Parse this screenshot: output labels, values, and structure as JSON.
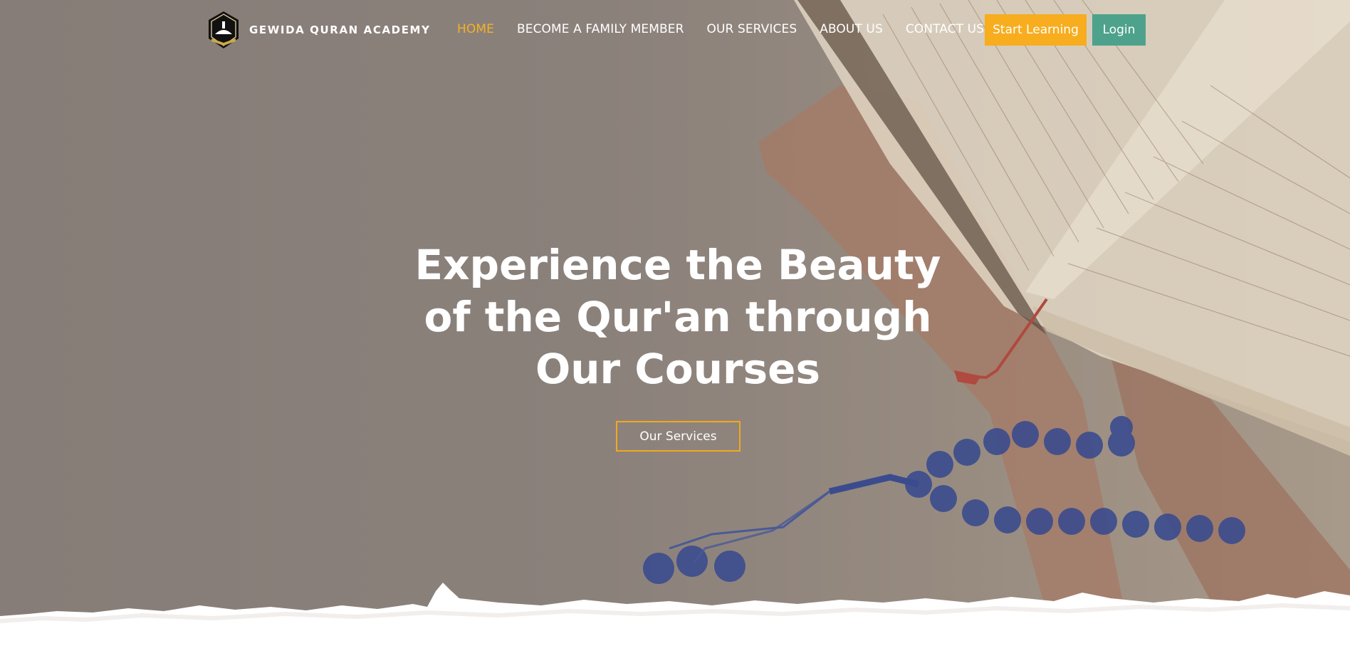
{
  "brand": {
    "name": "GEWIDA QURAN ACADEMY",
    "logo_icon": "mosque-quran-emblem-icon"
  },
  "nav": {
    "items": [
      {
        "label": "HOME",
        "active": true
      },
      {
        "label": "BECOME A FAMILY MEMBER",
        "active": false
      },
      {
        "label": "OUR SERVICES",
        "active": false
      },
      {
        "label": "ABOUT US",
        "active": false
      },
      {
        "label": "CONTACT US",
        "active": false
      }
    ]
  },
  "actions": {
    "start_label": "Start Learning",
    "login_label": "Login"
  },
  "hero": {
    "headline": "Experience the Beauty of the Qur'an through Our Courses",
    "cta_label": "Our Services",
    "background_icon": "open-quran-with-prayer-beads-image"
  },
  "colors": {
    "accent": "#f7ad1e",
    "login": "#4ea28b",
    "active_nav": "#f6b126",
    "overlay": "#877d78"
  }
}
